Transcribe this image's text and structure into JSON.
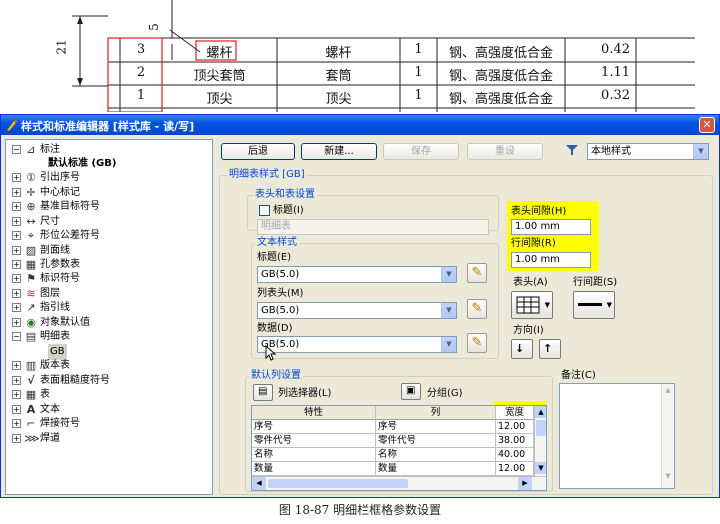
{
  "drawing": {
    "dim_vertical": "21",
    "dim_top": "5",
    "rows": [
      {
        "seq": "3",
        "code": "螺杆",
        "name": "螺杆",
        "qty": "1",
        "material": "钢、高强度低合金",
        "mass": "0.42"
      },
      {
        "seq": "2",
        "code": "顶尖套筒",
        "name": "套筒",
        "qty": "1",
        "material": "钢、高强度低合金",
        "mass": "1.11"
      },
      {
        "seq": "1",
        "code": "顶尖",
        "name": "顶尖",
        "qty": "1",
        "material": "钢、高强度低合金",
        "mass": "0.32"
      }
    ]
  },
  "window": {
    "title": "样式和标准编辑器 [样式库 - 读/写]",
    "close_label": "✕"
  },
  "tree": {
    "items": [
      {
        "label": "标注",
        "icon": "dimension-icon",
        "glyph": "⊿",
        "expanded": true,
        "level": 0
      },
      {
        "label": "默认标准 (GB)",
        "icon": "",
        "glyph": "",
        "bold": true,
        "level": 1
      },
      {
        "label": "引出序号",
        "icon": "balloon-icon",
        "glyph": "①",
        "level": 0
      },
      {
        "label": "中心标记",
        "icon": "center-mark-icon",
        "glyph": "✛",
        "level": 0
      },
      {
        "label": "基准目标符号",
        "icon": "datum-target-icon",
        "glyph": "⊕",
        "level": 0
      },
      {
        "label": "尺寸",
        "icon": "size-icon",
        "glyph": "↔",
        "level": 0
      },
      {
        "label": "形位公差符号",
        "icon": "tolerance-icon",
        "glyph": "⌖",
        "level": 0
      },
      {
        "label": "剖面线",
        "icon": "hatch-icon",
        "glyph": "▨",
        "level": 0
      },
      {
        "label": "孔参数表",
        "icon": "hole-table-icon",
        "glyph": "▦",
        "level": 0
      },
      {
        "label": "标识符号",
        "icon": "identifier-icon",
        "glyph": "⚑",
        "level": 0
      },
      {
        "label": "图层",
        "icon": "layer-icon",
        "glyph": "≋",
        "level": 0
      },
      {
        "label": "指引线",
        "icon": "leader-icon",
        "glyph": "↗",
        "level": 0
      },
      {
        "label": "对象默认值",
        "icon": "object-default-icon",
        "glyph": "◉",
        "level": 0
      },
      {
        "label": "明细表",
        "icon": "parts-list-icon",
        "glyph": "▤",
        "expanded": true,
        "level": 0
      },
      {
        "label": "GB",
        "icon": "",
        "glyph": "",
        "selected": true,
        "level": 1
      },
      {
        "label": "版本表",
        "icon": "revision-table-icon",
        "glyph": "▥",
        "level": 0
      },
      {
        "label": "表面粗糙度符号",
        "icon": "surface-texture-icon",
        "glyph": "√",
        "level": 0
      },
      {
        "label": "表",
        "icon": "table-icon",
        "glyph": "▦",
        "level": 0
      },
      {
        "label": "文本",
        "icon": "text-icon",
        "glyph": "A",
        "level": 0
      },
      {
        "label": "焊接符号",
        "icon": "weld-symbol-icon",
        "glyph": "⌐",
        "level": 0
      },
      {
        "label": "焊道",
        "icon": "weld-bead-icon",
        "glyph": "⋙",
        "level": 0
      }
    ]
  },
  "toolbar": {
    "back": "后退",
    "new": "新建...",
    "save": "保存",
    "reset": "重设",
    "filter_value": "本地样式"
  },
  "style": {
    "group_title": "明细表样式 [GB]",
    "header_title_group": "表头和表设置",
    "title_checkbox": "标题(I)",
    "title_placeholder": "明细表",
    "text_style_group": "文本样式",
    "title_label": "标题(E)",
    "title_value": "GB(5.0)",
    "col_header_label": "列表头(M)",
    "col_header_value": "GB(5.0)",
    "data_label": "数据(D)",
    "data_value": "GB(5.0)",
    "header_gap_label": "表头间隙(H)",
    "header_gap_value": "1.00 mm",
    "row_gap_label": "行间隙(R)",
    "row_gap_value": "1.00 mm",
    "border_label": "表头(A)",
    "line_spacing_label": "行间距(S)",
    "direction_label": "方向(I)",
    "default_col_group": "默认列设置",
    "column_chooser": "列选择器(L)",
    "group_button": "分组(G)",
    "notes_label": "备注(C)"
  },
  "grid": {
    "headers": [
      "特性",
      "列",
      "宽度"
    ],
    "rows": [
      {
        "prop": "序号",
        "col": "序号",
        "width": "12.00"
      },
      {
        "prop": "零件代号",
        "col": "零件代号",
        "width": "38.00"
      },
      {
        "prop": "名称",
        "col": "名称",
        "width": "40.00"
      },
      {
        "prop": "数量",
        "col": "数量",
        "width": "12.00"
      }
    ]
  },
  "caption": "图 18-87   明细栏框格参数设置"
}
